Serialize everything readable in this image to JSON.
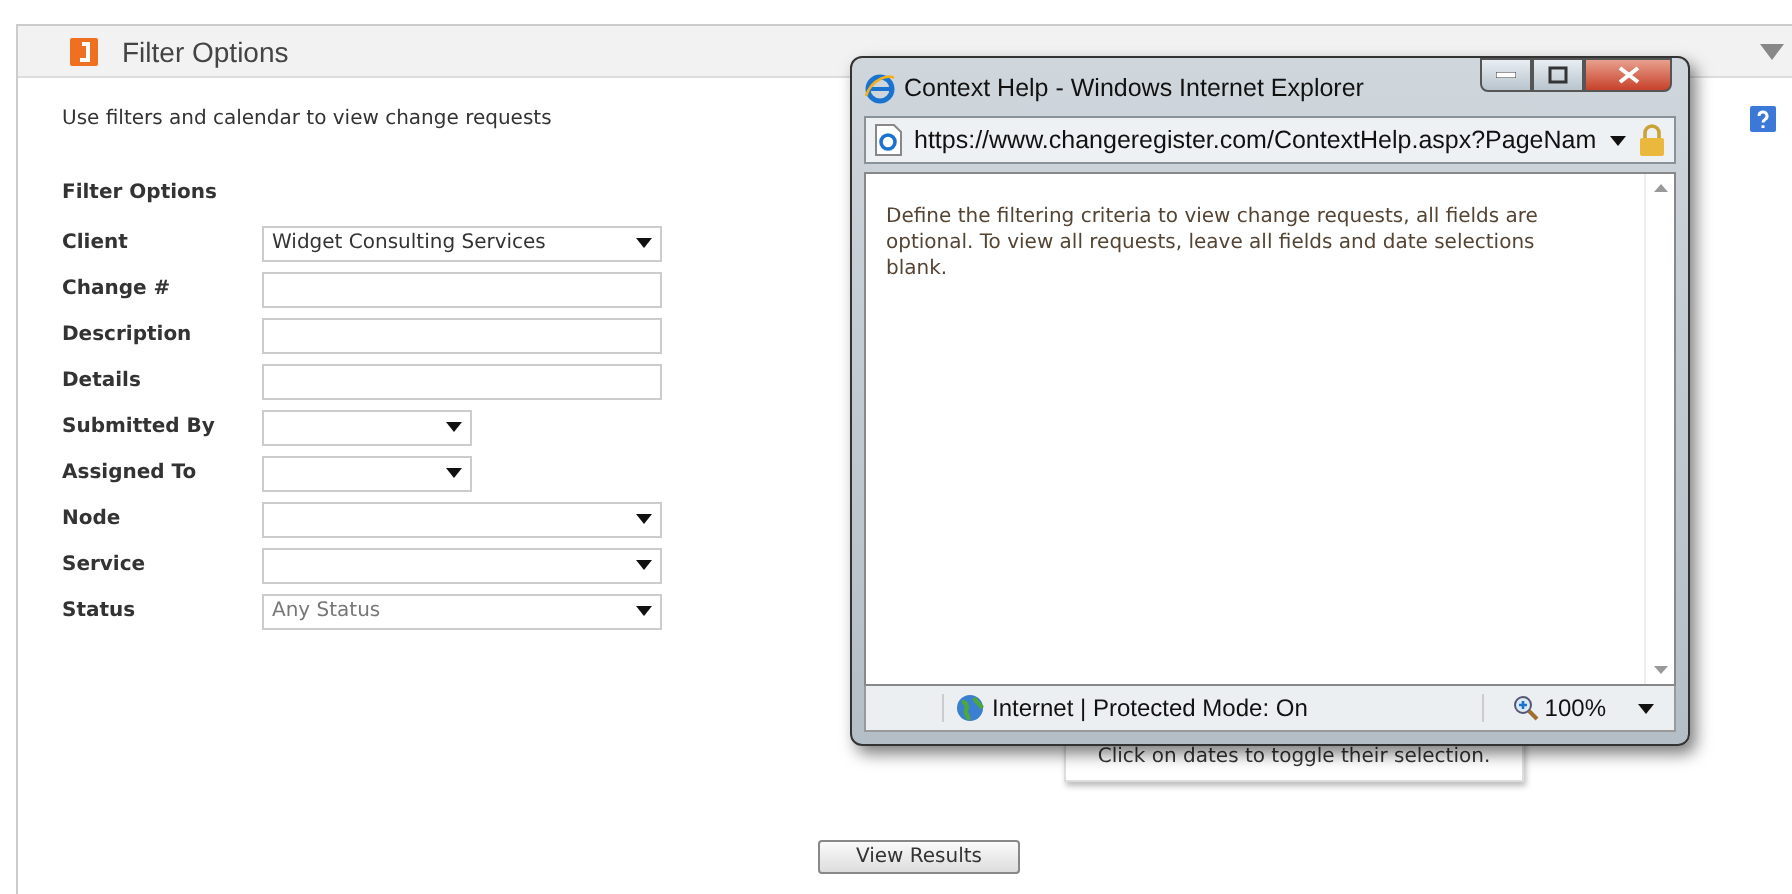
{
  "panel": {
    "title": "Filter Options",
    "intro": "Use filters and calendar to view change requests",
    "section_title": "Filter Options",
    "fields": [
      {
        "label": "Client",
        "kind": "select",
        "value": "Widget Consulting Services"
      },
      {
        "label": "Change #",
        "kind": "text"
      },
      {
        "label": "Description",
        "kind": "text"
      },
      {
        "label": "Details",
        "kind": "text"
      },
      {
        "label": "Submitted By",
        "kind": "short-select"
      },
      {
        "label": "Assigned To",
        "kind": "short-select"
      },
      {
        "label": "Node",
        "kind": "select"
      },
      {
        "label": "Service",
        "kind": "select"
      },
      {
        "label": "Status",
        "kind": "select",
        "placeholder": "Any Status"
      }
    ],
    "calendar_hint": "Click on dates to toggle their selection.",
    "button": "View Results"
  },
  "popup": {
    "title": "Context Help - Windows Internet Explorer",
    "address": "https://www.changeregister.com/ContextHelp.aspx?PageNam",
    "body": "Define the filtering criteria to view change requests, all fields are optional. To view all requests, leave all fields and date selections blank.",
    "status": "Internet | Protected Mode: On",
    "zoom": "100%"
  }
}
